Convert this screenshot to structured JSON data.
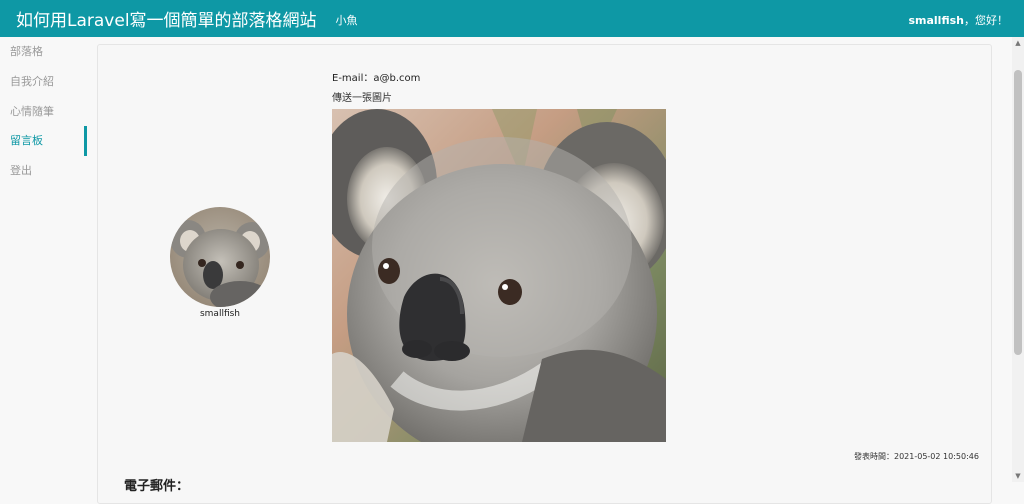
{
  "header": {
    "title": "如何用Laravel寫一個簡單的部落格網站",
    "subtitle": "小魚",
    "user_name": "smallfish",
    "greeting_suffix": "，您好！"
  },
  "sidebar": {
    "items": [
      {
        "label": "部落格",
        "active": false
      },
      {
        "label": "自我介紹",
        "active": false
      },
      {
        "label": "心情隨筆",
        "active": false
      },
      {
        "label": "留言板",
        "active": true
      },
      {
        "label": "登出",
        "active": false
      }
    ]
  },
  "post": {
    "email": "E-mail：a@b.com",
    "message": "傳送一張圖片",
    "author": "smallfish",
    "timestamp": "發表時間：2021-05-02 10:50:46",
    "next_heading": "電子郵件："
  },
  "colors": {
    "accent": "#0e98a5"
  }
}
